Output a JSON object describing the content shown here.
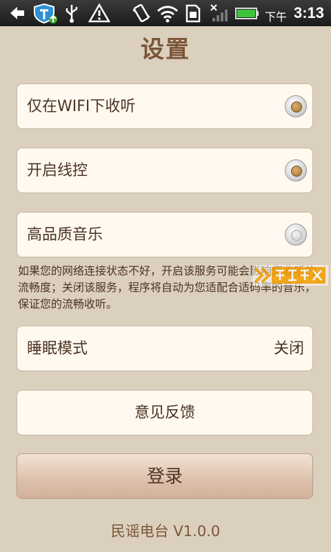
{
  "status_bar": {
    "ampm": "下午",
    "time": "3:13",
    "icons": [
      "back-icon",
      "shield-icon",
      "usb-icon",
      "warning-icon",
      "vibrate-icon",
      "wifi-icon",
      "sim-icon",
      "signal-icon",
      "battery-icon"
    ]
  },
  "page": {
    "title": "设置"
  },
  "settings": {
    "wifi_only_label": "仅在WIFI下收听",
    "wifi_only_checked": true,
    "remote_control_label": "开启线控",
    "remote_control_checked": true,
    "high_quality_label": "高品质音乐",
    "high_quality_checked": false,
    "high_quality_note": "如果您的网络连接状态不好，开启该服务可能会影响您收听的流畅度；关闭该服务，程序将自动为您适配合适码率的音乐，保证您的流畅收听。",
    "sleep_mode_label": "睡眠模式",
    "sleep_mode_value": "关闭",
    "feedback_label": "意见反馈",
    "login_label": "登录"
  },
  "footer": {
    "version": "民谣电台 V1.0.0"
  },
  "watermark": {
    "text": "快盘下载"
  },
  "colors": {
    "background": "#dbcfbe",
    "row_bg": "#fff9ef",
    "text": "#4d3424",
    "accent": "#7b5638"
  }
}
